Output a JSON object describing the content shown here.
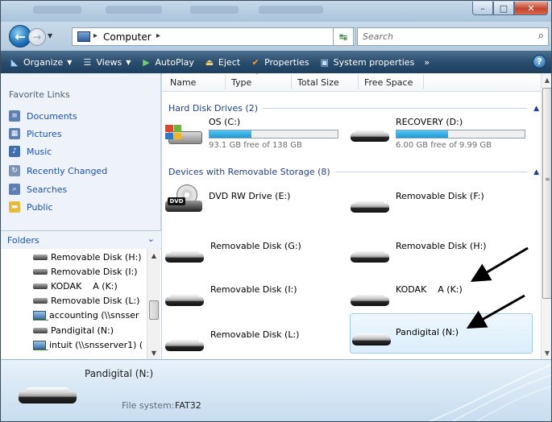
{
  "address": {
    "path_label": "Computer",
    "search_placeholder": "Search"
  },
  "toolbar": {
    "organize": "Organize",
    "views": "Views",
    "autoplay": "AutoPlay",
    "eject": "Eject",
    "properties": "Properties",
    "system_properties": "System properties",
    "more": "»"
  },
  "favorites": {
    "title": "Favorite Links",
    "items": [
      {
        "label": "Documents",
        "icon": "documents-icon"
      },
      {
        "label": "Pictures",
        "icon": "pictures-icon"
      },
      {
        "label": "Music",
        "icon": "music-icon"
      },
      {
        "label": "Recently Changed",
        "icon": "recently-changed-icon"
      },
      {
        "label": "Searches",
        "icon": "searches-icon"
      },
      {
        "label": "Public",
        "icon": "public-folder-icon"
      }
    ]
  },
  "folders": {
    "title": "Folders",
    "items": [
      {
        "label": "Removable Disk (H:)",
        "icon": "removable-disk-icon"
      },
      {
        "label": "Removable Disk (I:)",
        "icon": "removable-disk-icon"
      },
      {
        "label": "KODAK    A (K:)",
        "icon": "removable-disk-icon"
      },
      {
        "label": "Removable Disk (L:)",
        "icon": "removable-disk-icon"
      },
      {
        "label": "accounting (\\\\snsser",
        "icon": "network-drive-icon"
      },
      {
        "label": "Pandigital (N:)",
        "icon": "removable-disk-icon"
      },
      {
        "label": "intuit (\\\\snsserver1) (",
        "icon": "network-drive-icon"
      }
    ]
  },
  "columns": [
    "Name",
    "Type",
    "Total Size",
    "Free Space"
  ],
  "groups": {
    "hdd": "Hard Disk Drives (2)",
    "removable": "Devices with Removable Storage (8)"
  },
  "hard_drives": [
    {
      "name": "OS (C:)",
      "free_text": "93.1 GB free of 138 GB",
      "used_fraction": 0.33
    },
    {
      "name": "RECOVERY (D:)",
      "free_text": "6.00 GB free of 9.99 GB",
      "used_fraction": 0.4
    }
  ],
  "removable": [
    {
      "name": "DVD RW Drive (E:)"
    },
    {
      "name": "Removable Disk (F:)"
    },
    {
      "name": "Removable Disk (G:)"
    },
    {
      "name": "Removable Disk (H:)"
    },
    {
      "name": "Removable Disk (I:)"
    },
    {
      "name": "KODAK    A (K:)"
    },
    {
      "name": "Removable Disk (L:)"
    },
    {
      "name": "Pandigital (N:)"
    }
  ],
  "details": {
    "title": "Pandigital (N:)",
    "fs_label": "File system:",
    "fs_value": "FAT32"
  }
}
